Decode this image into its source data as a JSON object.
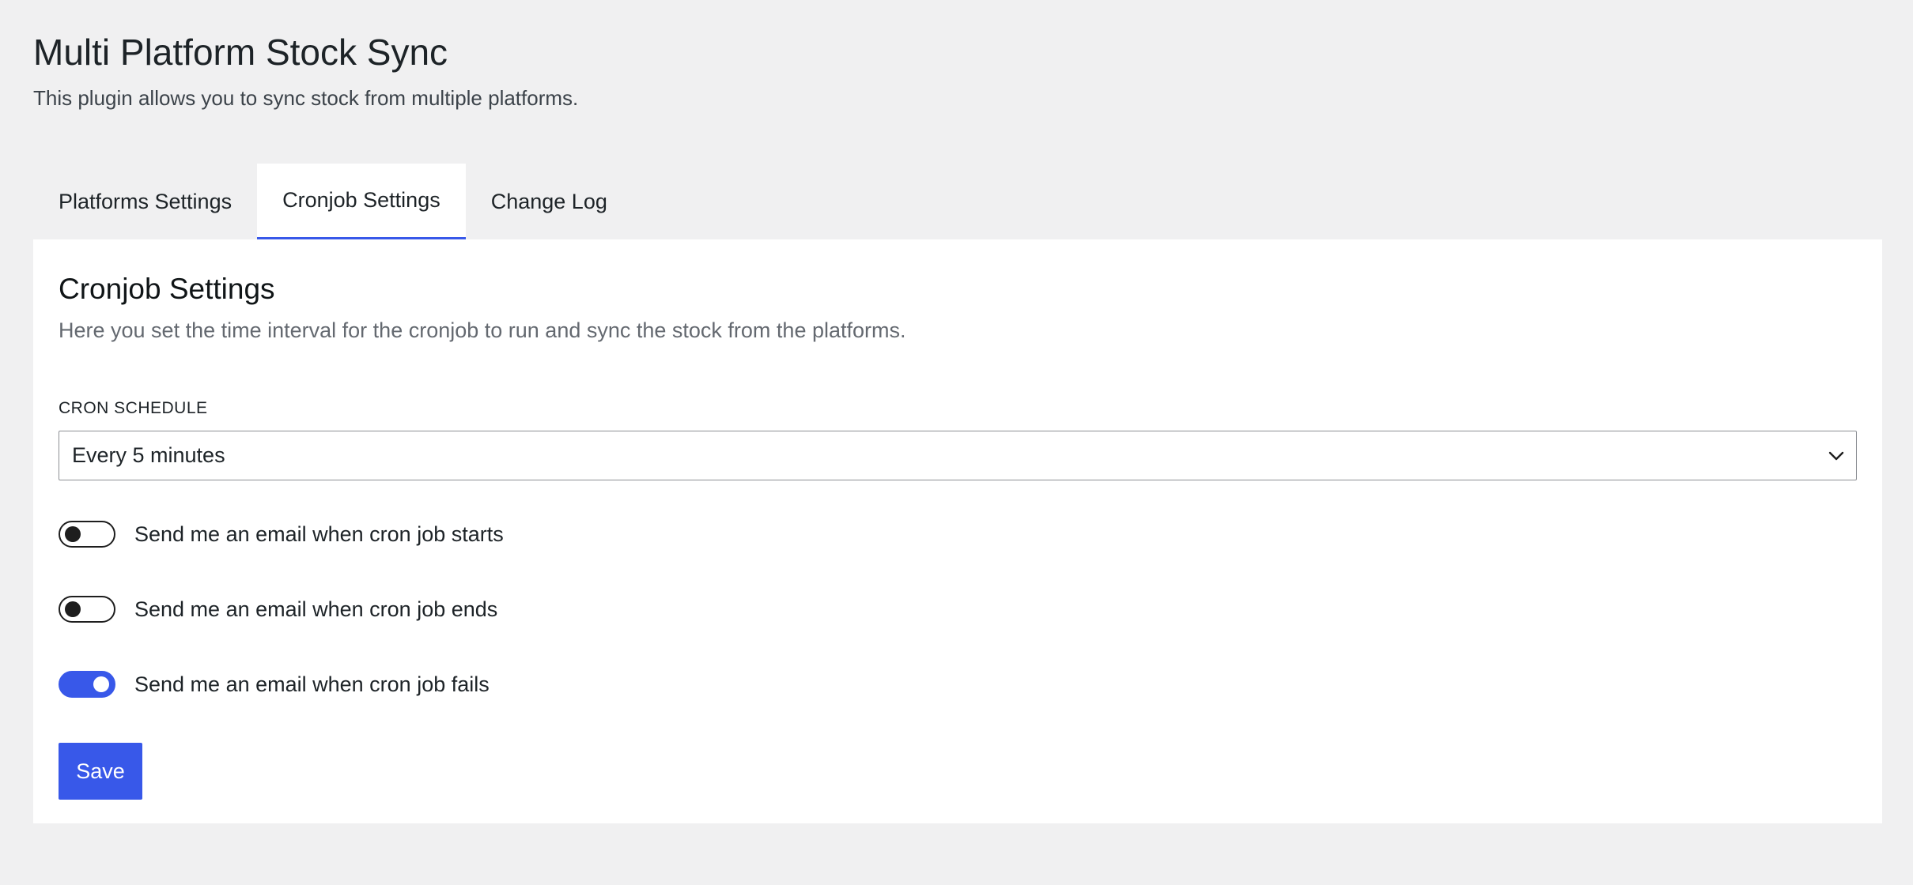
{
  "header": {
    "title": "Multi Platform Stock Sync",
    "description": "This plugin allows you to sync stock from multiple platforms."
  },
  "tabs": [
    {
      "label": "Platforms Settings",
      "active": false
    },
    {
      "label": "Cronjob Settings",
      "active": true
    },
    {
      "label": "Change Log",
      "active": false
    }
  ],
  "section": {
    "title": "Cronjob Settings",
    "description": "Here you set the time interval for the cronjob to run and sync the stock from the platforms."
  },
  "cron_schedule": {
    "label": "CRON SCHEDULE",
    "selected": "Every 5 minutes",
    "icon": "chevron-down-icon"
  },
  "toggles": [
    {
      "label": "Send me an email when cron job starts",
      "enabled": false
    },
    {
      "label": "Send me an email when cron job ends",
      "enabled": false
    },
    {
      "label": "Send me an email when cron job fails",
      "enabled": true
    }
  ],
  "save_label": "Save",
  "colors": {
    "accent": "#3858e9",
    "background": "#f0f0f1",
    "panel": "#ffffff"
  }
}
